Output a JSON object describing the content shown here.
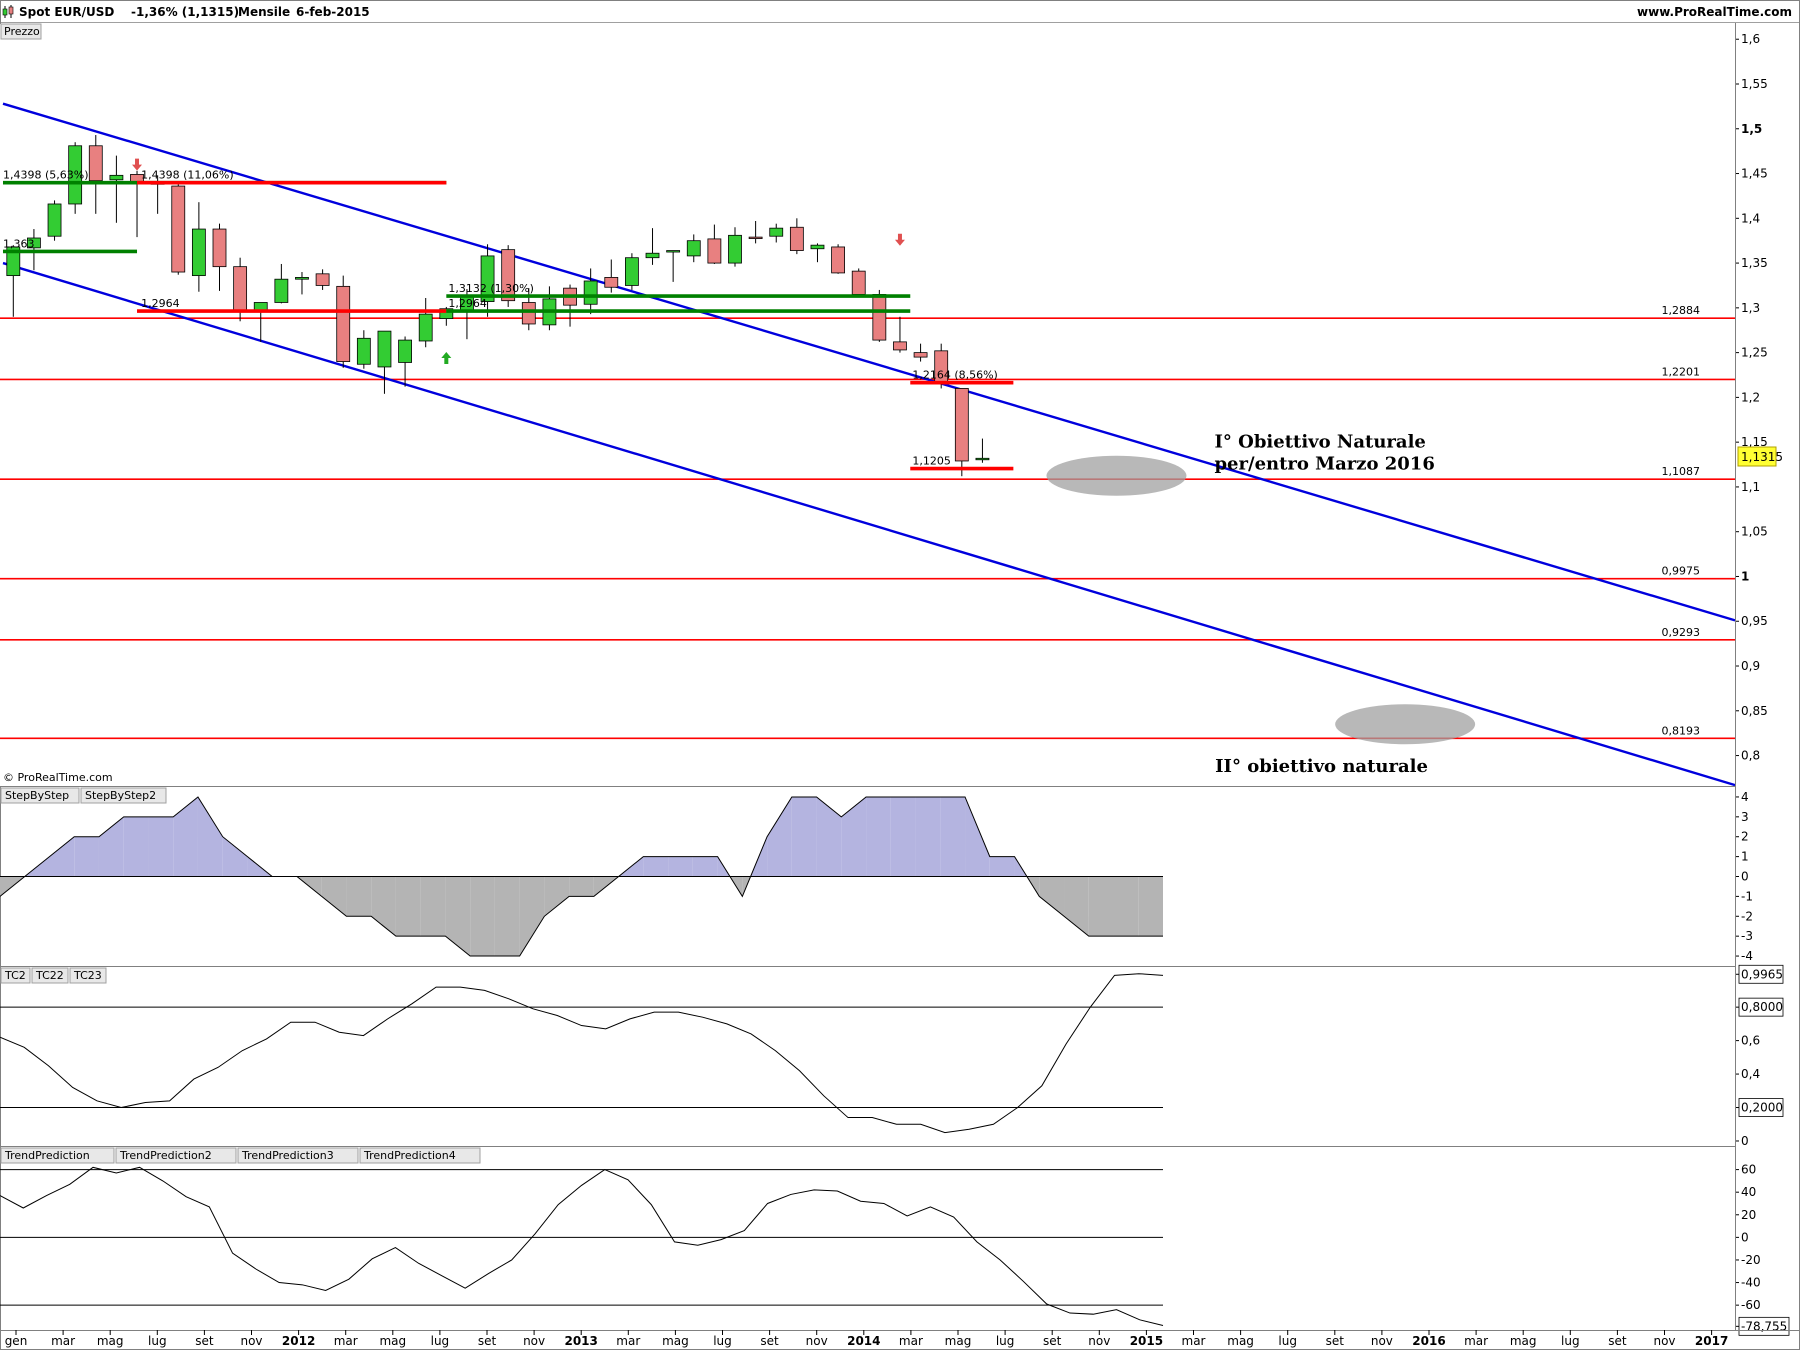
{
  "header": {
    "symbol": "Spot EUR/USD",
    "change": "-1,36% (1,1315)",
    "timeframe": "Mensile",
    "date": "6-feb-2015",
    "site": "www.ProRealTime.com",
    "copyright": "© ProRealTime.com"
  },
  "colors": {
    "bullish": "#33cc33",
    "bearish": "#e88080",
    "channel": "#0000dd",
    "support": "#ff0000",
    "green_level": "#008000",
    "pos_area": "#b4b4e0",
    "neg_area": "#b4b4b4",
    "target_zone": "#a0a0a0"
  },
  "chart_data": [
    {
      "type": "candlestick",
      "panel_label": "Prezzo",
      "x_tick_labels": [
        "gen",
        "mar",
        "mag",
        "lug",
        "set",
        "nov",
        "2012",
        "mar",
        "mag",
        "lug",
        "set",
        "nov",
        "2013",
        "mar",
        "mag",
        "lug",
        "set",
        "nov",
        "2014",
        "mar",
        "mag",
        "lug",
        "set",
        "nov",
        "2015",
        "mar",
        "mag",
        "lug",
        "set",
        "nov",
        "2016",
        "mar",
        "mag",
        "lug",
        "set",
        "nov",
        "2017"
      ],
      "y_ticks": [
        "1,6",
        "1,55",
        "1,5",
        "1,45",
        "1,4",
        "1,35",
        "1,3",
        "1,25",
        "1,2",
        "1,15",
        "1,1",
        "1,05",
        "1",
        "0,95",
        "0,9",
        "0,85",
        "0,8"
      ],
      "ylim": [
        0.766,
        1.617
      ],
      "last_price": "1,1315",
      "candles": [
        {
          "o": 1.336,
          "h": 1.37,
          "l": 1.29,
          "c": 1.368
        },
        {
          "o": 1.367,
          "h": 1.388,
          "l": 1.342,
          "c": 1.378
        },
        {
          "o": 1.38,
          "h": 1.42,
          "l": 1.375,
          "c": 1.416
        },
        {
          "o": 1.416,
          "h": 1.485,
          "l": 1.405,
          "c": 1.481
        },
        {
          "o": 1.481,
          "h": 1.493,
          "l": 1.405,
          "c": 1.442
        },
        {
          "o": 1.443,
          "h": 1.47,
          "l": 1.395,
          "c": 1.448
        },
        {
          "o": 1.449,
          "h": 1.453,
          "l": 1.379,
          "c": 1.44
        },
        {
          "o": 1.44,
          "h": 1.448,
          "l": 1.405,
          "c": 1.438
        },
        {
          "o": 1.436,
          "h": 1.44,
          "l": 1.337,
          "c": 1.34
        },
        {
          "o": 1.336,
          "h": 1.418,
          "l": 1.318,
          "c": 1.388
        },
        {
          "o": 1.388,
          "h": 1.394,
          "l": 1.319,
          "c": 1.346
        },
        {
          "o": 1.346,
          "h": 1.356,
          "l": 1.285,
          "c": 1.296
        },
        {
          "o": 1.296,
          "h": 1.303,
          "l": 1.262,
          "c": 1.306
        },
        {
          "o": 1.306,
          "h": 1.349,
          "l": 1.305,
          "c": 1.332
        },
        {
          "o": 1.332,
          "h": 1.34,
          "l": 1.315,
          "c": 1.334
        },
        {
          "o": 1.338,
          "h": 1.343,
          "l": 1.32,
          "c": 1.325
        },
        {
          "o": 1.324,
          "h": 1.336,
          "l": 1.233,
          "c": 1.24
        },
        {
          "o": 1.237,
          "h": 1.275,
          "l": 1.232,
          "c": 1.266
        },
        {
          "o": 1.234,
          "h": 1.272,
          "l": 1.204,
          "c": 1.274
        },
        {
          "o": 1.239,
          "h": 1.268,
          "l": 1.212,
          "c": 1.264
        },
        {
          "o": 1.263,
          "h": 1.311,
          "l": 1.256,
          "c": 1.293
        },
        {
          "o": 1.288,
          "h": 1.301,
          "l": 1.28,
          "c": 1.299
        },
        {
          "o": 1.296,
          "h": 1.321,
          "l": 1.265,
          "c": 1.313
        },
        {
          "o": 1.307,
          "h": 1.371,
          "l": 1.29,
          "c": 1.358
        },
        {
          "o": 1.365,
          "h": 1.37,
          "l": 1.301,
          "c": 1.308
        },
        {
          "o": 1.306,
          "h": 1.322,
          "l": 1.275,
          "c": 1.282
        },
        {
          "o": 1.281,
          "h": 1.324,
          "l": 1.275,
          "c": 1.31
        },
        {
          "o": 1.322,
          "h": 1.326,
          "l": 1.279,
          "c": 1.303
        },
        {
          "o": 1.304,
          "h": 1.344,
          "l": 1.293,
          "c": 1.33
        },
        {
          "o": 1.334,
          "h": 1.354,
          "l": 1.317,
          "c": 1.323
        },
        {
          "o": 1.325,
          "h": 1.361,
          "l": 1.32,
          "c": 1.356
        },
        {
          "o": 1.356,
          "h": 1.389,
          "l": 1.348,
          "c": 1.361
        },
        {
          "o": 1.363,
          "h": 1.364,
          "l": 1.329,
          "c": 1.364
        },
        {
          "o": 1.358,
          "h": 1.382,
          "l": 1.351,
          "c": 1.375
        },
        {
          "o": 1.377,
          "h": 1.393,
          "l": 1.349,
          "c": 1.35
        },
        {
          "o": 1.35,
          "h": 1.39,
          "l": 1.346,
          "c": 1.381
        },
        {
          "o": 1.379,
          "h": 1.397,
          "l": 1.372,
          "c": 1.378
        },
        {
          "o": 1.38,
          "h": 1.394,
          "l": 1.373,
          "c": 1.389
        },
        {
          "o": 1.39,
          "h": 1.4,
          "l": 1.36,
          "c": 1.364
        },
        {
          "o": 1.366,
          "h": 1.372,
          "l": 1.351,
          "c": 1.37
        },
        {
          "o": 1.368,
          "h": 1.371,
          "l": 1.338,
          "c": 1.339
        },
        {
          "o": 1.341,
          "h": 1.344,
          "l": 1.315,
          "c": 1.315
        },
        {
          "o": 1.315,
          "h": 1.32,
          "l": 1.262,
          "c": 1.264
        },
        {
          "o": 1.262,
          "h": 1.29,
          "l": 1.25,
          "c": 1.253
        },
        {
          "o": 1.25,
          "h": 1.26,
          "l": 1.24,
          "c": 1.245
        },
        {
          "o": 1.252,
          "h": 1.26,
          "l": 1.21,
          "c": 1.216
        },
        {
          "o": 1.21,
          "h": 1.21,
          "l": 1.112,
          "c": 1.129
        },
        {
          "o": 1.131,
          "h": 1.154,
          "l": 1.127,
          "c": 1.132
        }
      ],
      "channel_lines": [
        {
          "from": {
            "month": -0.5,
            "price": 1.528
          },
          "to": {
            "month": 83.5,
            "price": 0.951
          }
        },
        {
          "from": {
            "month": -0.5,
            "price": 1.35
          },
          "to": {
            "month": 83.5,
            "price": 0.767
          }
        }
      ],
      "horizontal_levels": [
        {
          "price": 1.2884,
          "label": "1,2884"
        },
        {
          "price": 1.2201,
          "label": "1,2201"
        },
        {
          "price": 1.1087,
          "label": "1,1087"
        },
        {
          "price": 0.9975,
          "label": "0,9975"
        },
        {
          "price": 0.9293,
          "label": "0,9293"
        },
        {
          "price": 0.8193,
          "label": "0,8193"
        }
      ],
      "segment_levels": [
        {
          "price": 1.4398,
          "from": -0.5,
          "to": 21,
          "style": "green",
          "label": "1,4398 (5,63%)",
          "label_month": -0.5
        },
        {
          "price": 1.4398,
          "from": 6,
          "to": 21,
          "style": "red",
          "label": "1,4398 (11,06%)",
          "label_month": 6.2
        },
        {
          "price": 1.363,
          "from": -0.5,
          "to": 6,
          "style": "green",
          "label": "1,363",
          "label_month": -0.5
        },
        {
          "price": 1.2964,
          "from": 6,
          "to": 21,
          "style": "red",
          "label": "1,2964",
          "label_month": 6.2
        },
        {
          "price": 1.3132,
          "from": 21,
          "to": 43.5,
          "style": "green",
          "label": "1,3132 (1,30%)",
          "label_month": 21.1
        },
        {
          "price": 1.2964,
          "from": 21,
          "to": 43.5,
          "style": "green",
          "label": "1,2964",
          "label_month": 21.1
        },
        {
          "price": 1.2164,
          "from": 43.5,
          "to": 48.5,
          "style": "red",
          "label": "1,2164 (8,56%)",
          "label_month": 43.6
        },
        {
          "price": 1.1205,
          "from": 43.5,
          "to": 48.5,
          "style": "red",
          "label": "1,1205",
          "label_month": 43.6
        }
      ],
      "signal_arrows": [
        {
          "month": 6,
          "price": 1.46,
          "dir": "down"
        },
        {
          "month": 21,
          "price": 1.244,
          "dir": "up"
        },
        {
          "month": 43,
          "price": 1.376,
          "dir": "down"
        }
      ],
      "target_zones": [
        {
          "month": 53.5,
          "price": 1.1125,
          "label_lines": [
            "I° Obiettivo Naturale",
            "per/entro Marzo 2016"
          ]
        },
        {
          "month": 67.5,
          "price": 0.835,
          "label_lines": [
            "II° obiettivo naturale"
          ]
        }
      ]
    },
    {
      "type": "area",
      "panel_labels": [
        "StepByStep",
        "StepByStep2"
      ],
      "y_ticks": [
        "4",
        "3",
        "2",
        "1",
        "0",
        "-1",
        "-2",
        "-3",
        "-4"
      ],
      "ylim": [
        -4.5,
        4.5
      ],
      "values": [
        -1,
        0,
        1,
        2,
        2,
        3,
        3,
        3,
        4,
        2,
        1,
        0,
        0,
        -1,
        -2,
        -2,
        -3,
        -3,
        -3,
        -4,
        -4,
        -4,
        -2,
        -1,
        -1,
        0,
        1,
        1,
        1,
        1,
        -1,
        2,
        4,
        4,
        3,
        4,
        4,
        4,
        4,
        4,
        1,
        1,
        -1,
        -2,
        -3,
        -3,
        -3,
        -3
      ],
      "marker": "-3"
    },
    {
      "type": "line",
      "panel_labels": [
        "TC2",
        "TC22",
        "TC23"
      ],
      "y_ticks": [
        "0,9965",
        "0,8000",
        "0,6",
        "0,4",
        "0,2000",
        "0"
      ],
      "ylim": [
        -0.03,
        1.04
      ],
      "reference_levels": [
        0.8,
        0.2
      ],
      "values": [
        0.62,
        0.56,
        0.45,
        0.32,
        0.24,
        0.2,
        0.23,
        0.24,
        0.37,
        0.44,
        0.54,
        0.61,
        0.71,
        0.71,
        0.65,
        0.63,
        0.73,
        0.82,
        0.92,
        0.92,
        0.9,
        0.85,
        0.79,
        0.75,
        0.69,
        0.67,
        0.73,
        0.77,
        0.77,
        0.74,
        0.7,
        0.64,
        0.54,
        0.42,
        0.27,
        0.14,
        0.14,
        0.1,
        0.1,
        0.05,
        0.07,
        0.1,
        0.2,
        0.33,
        0.58,
        0.8,
        0.99,
        1.0,
        0.99
      ]
    },
    {
      "type": "line",
      "panel_labels": [
        "TrendPrediction",
        "TrendPrediction2",
        "TrendPrediction3",
        "TrendPrediction4"
      ],
      "y_ticks": [
        "60",
        "40",
        "20",
        "0",
        "-20",
        "-40",
        "-60",
        "-78,755"
      ],
      "ylim": [
        -82,
        80
      ],
      "reference_levels": [
        60,
        0,
        -60
      ],
      "values": [
        37,
        26,
        37,
        47,
        62,
        57,
        62,
        50,
        36,
        27,
        -14,
        -28,
        -40,
        -42,
        -47,
        -37,
        -19,
        -9,
        -23,
        -34,
        -45,
        -32,
        -20,
        3,
        29,
        46,
        60,
        51,
        29,
        -4,
        -7,
        -2,
        6,
        30,
        38,
        42,
        41,
        32,
        30,
        19,
        27,
        18,
        -4,
        -20,
        -39,
        -59,
        -67,
        -68,
        -64,
        -73,
        -78
      ]
    }
  ]
}
